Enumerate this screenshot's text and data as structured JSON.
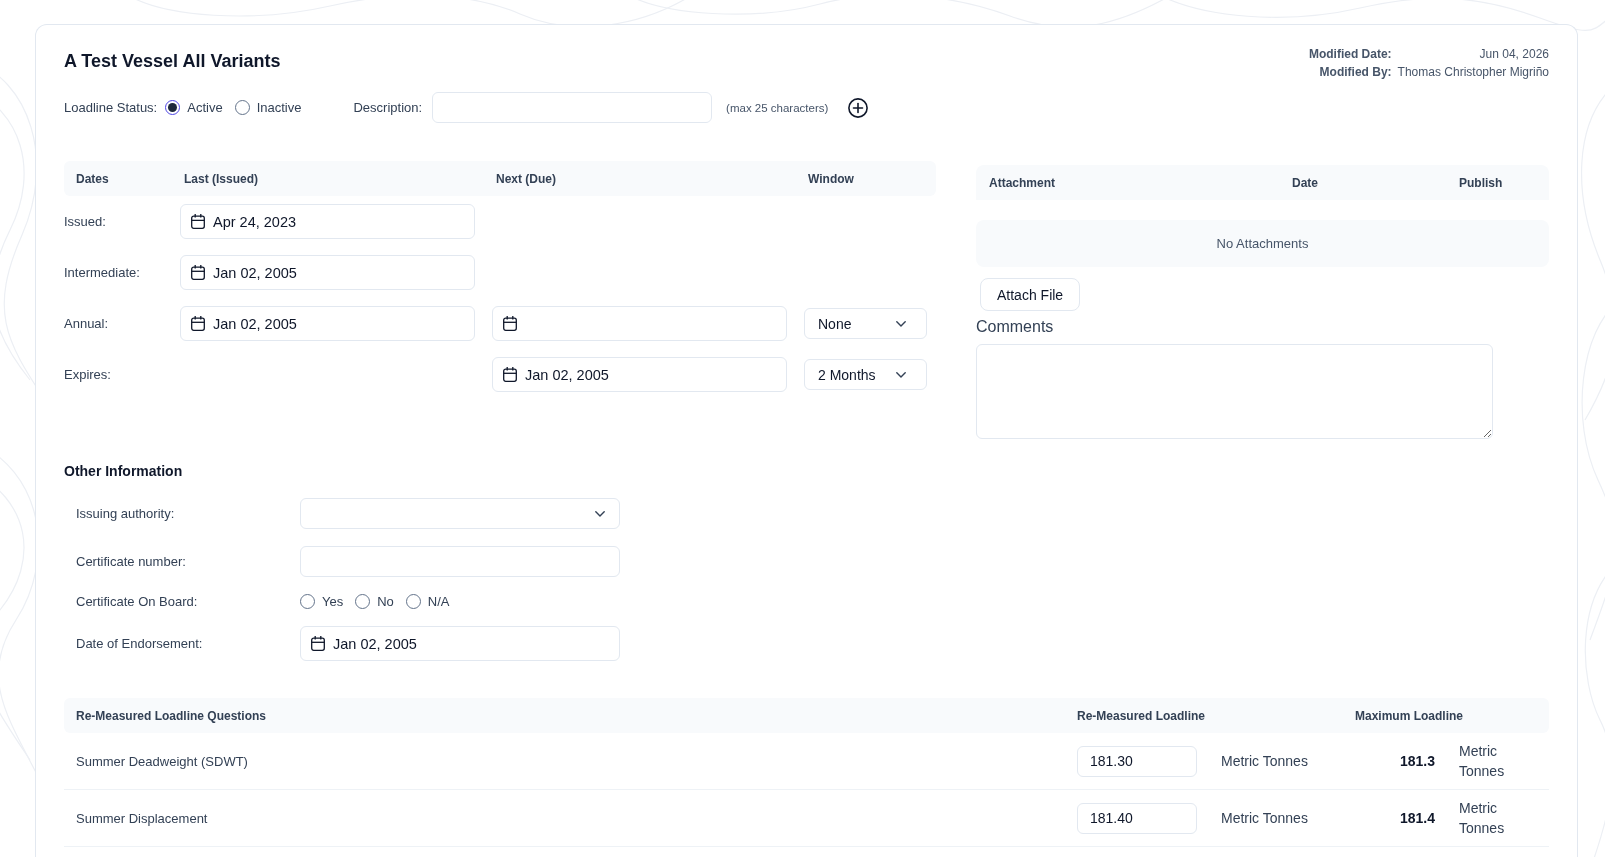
{
  "header": {
    "title": "A Test Vessel All Variants",
    "modified": [
      {
        "label": "Modified Date:",
        "value": "Jun 04, 2026"
      },
      {
        "label": "Modified By:",
        "value": "Thomas Christopher Migriño"
      }
    ]
  },
  "loadline_status": {
    "label": "Loadline Status:",
    "options": [
      {
        "label": "Active",
        "selected": true
      },
      {
        "label": "Inactive",
        "selected": false
      }
    ]
  },
  "description": {
    "label": "Description:",
    "hint": "(max 25 characters)"
  },
  "dates": {
    "columns": [
      "Dates",
      "Last (Issued)",
      "Next (Due)",
      "Window"
    ],
    "rows": [
      {
        "label": "Issued:",
        "last": {
          "kind": "date",
          "value": "Apr 24, 2023"
        }
      },
      {
        "label": "Intermediate:",
        "last": {
          "kind": "date",
          "value": "Jan 02, 2005"
        }
      },
      {
        "label": "Annual:",
        "last": {
          "kind": "date",
          "value": "Jan 02, 2005"
        },
        "next": {
          "kind": "date"
        },
        "window": {
          "kind": "select",
          "value": "None"
        }
      },
      {
        "label": "Expires:",
        "next": {
          "kind": "date",
          "value": "Jan 02, 2005"
        },
        "window": {
          "kind": "select",
          "value": "2 Months"
        }
      }
    ]
  },
  "attachments": {
    "columns": [
      "Attachment",
      "Date",
      "Publish"
    ],
    "empty_text": "No Attachments",
    "button": "Attach File"
  },
  "comments": {
    "label": "Comments"
  },
  "other_information": {
    "title": "Other Information",
    "fields": [
      {
        "label": "Issuing authority:",
        "kind": "select"
      },
      {
        "label": "Certificate number:",
        "kind": "text"
      },
      {
        "label": "Certificate On Board:",
        "kind": "radio",
        "options": [
          {
            "label": "Yes",
            "selected": false
          },
          {
            "label": "No",
            "selected": false
          },
          {
            "label": "N/A",
            "selected": false
          }
        ]
      },
      {
        "label": "Date of Endorsement:",
        "kind": "date",
        "value": "Jan 02, 2005"
      }
    ]
  },
  "remeasured": {
    "columns": [
      "Re-Measured Loadline Questions",
      "Re-Measured Loadline",
      "Maximum Loadline"
    ],
    "rows": [
      {
        "question": "Summer Deadweight (SDWT)",
        "value": "181.30",
        "unit": "Metric Tonnes",
        "maximum": "181.3",
        "maximum_unit": "Metric Tonnes"
      },
      {
        "question": "Summer Displacement",
        "value": "181.40",
        "unit": "Metric Tonnes",
        "maximum": "181.4",
        "maximum_unit": "Metric Tonnes"
      }
    ]
  }
}
